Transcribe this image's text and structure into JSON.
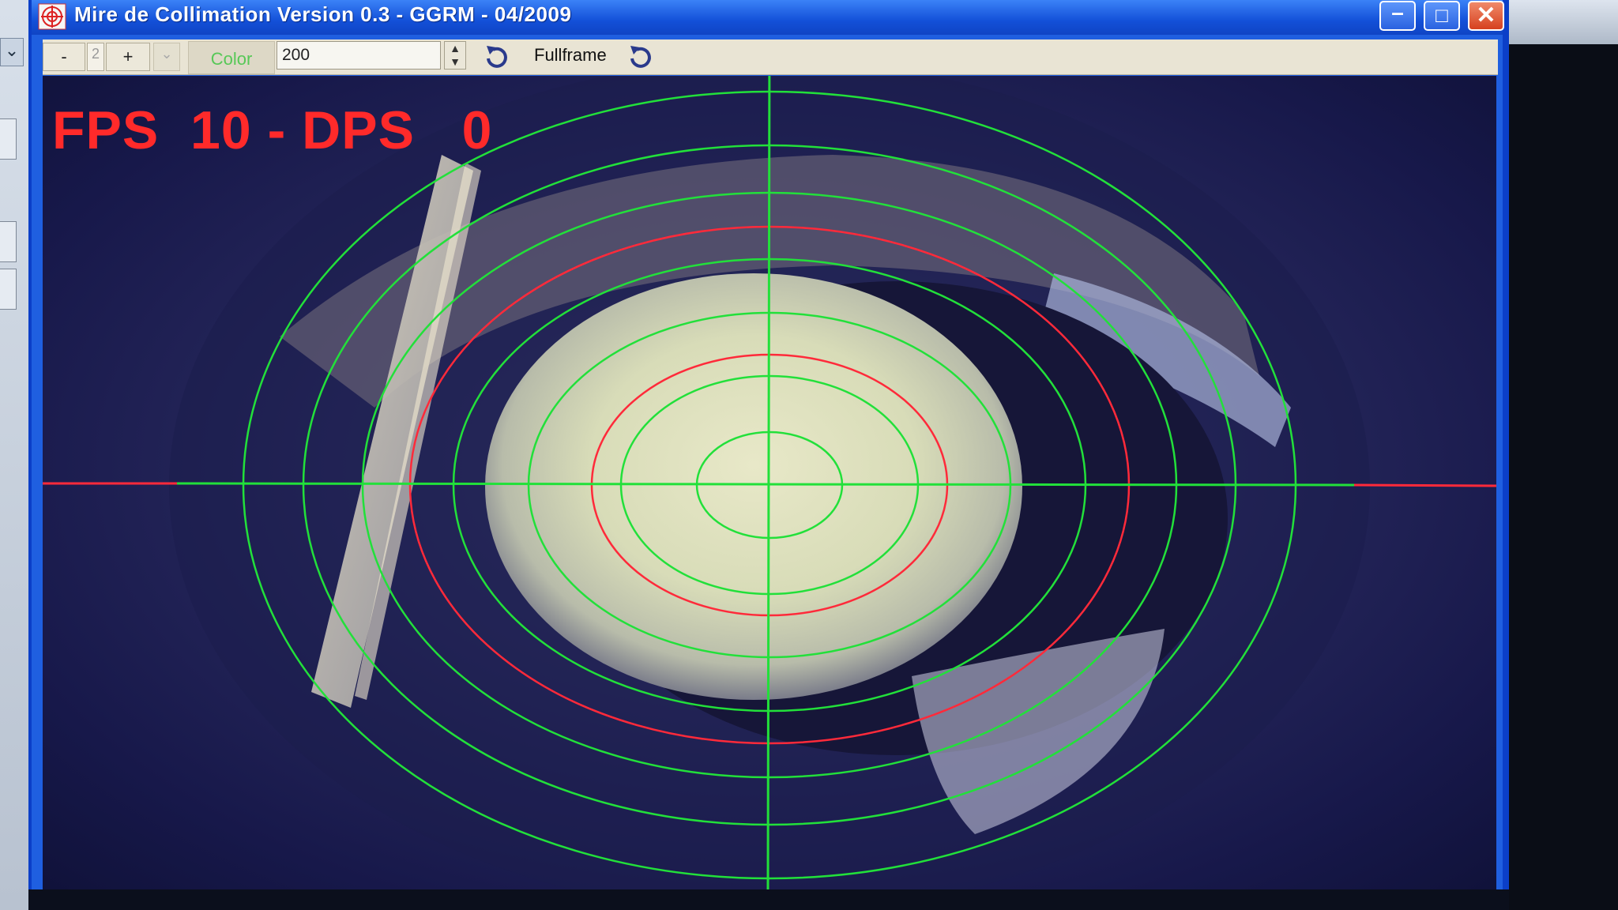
{
  "window": {
    "title": "Mire de Collimation  Version 0.3 - GGRM - 04/2009",
    "min_icon": "minimize-icon",
    "max_icon": "maximize-icon",
    "close_icon": "close-icon",
    "accent": "#1350d8"
  },
  "toolbar": {
    "minus_label": "-",
    "step_value": "2",
    "plus_label": "+",
    "color_label": "Color",
    "value_input": "200",
    "fullframe_label": "Fullframe",
    "refresh_icon": "refresh-icon",
    "color_text": "#57c857"
  },
  "overlay": {
    "fps_text": "FPS  10 - DPS   0",
    "fps_color": "#ff2a2a",
    "reticle_green": "#22e03a",
    "reticle_red": "#ff2a3a"
  }
}
